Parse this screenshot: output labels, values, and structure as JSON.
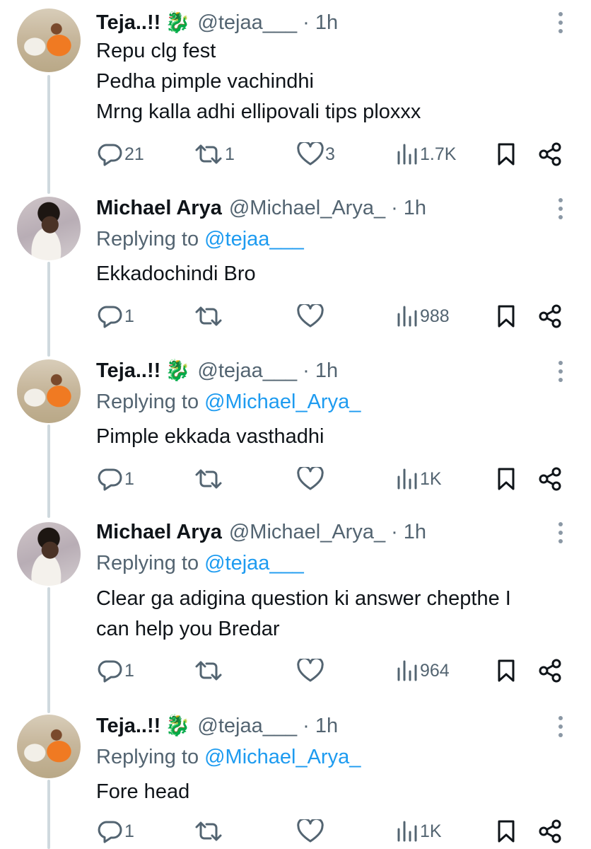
{
  "thread": {
    "tweets": [
      {
        "author": "Teja..!!",
        "author_emoji": "🐉",
        "handle": "@tejaa___",
        "time": "1h",
        "replying_label": "",
        "replying_to": "",
        "lines": [
          "Repu clg fest",
          "Pedha pimple vachindhi",
          "Mrng kalla adhi ellipovali tips ploxxx"
        ],
        "stats": {
          "replies": "21",
          "reposts": "1",
          "likes": "3",
          "views": "1.7K"
        }
      },
      {
        "author": "Michael Arya",
        "author_emoji": "",
        "handle": "@Michael_Arya_",
        "time": "1h",
        "replying_label": "Replying to",
        "replying_to": "@tejaa___",
        "lines": [
          "Ekkadochindi Bro"
        ],
        "stats": {
          "replies": "1",
          "reposts": "",
          "likes": "",
          "views": "988"
        }
      },
      {
        "author": "Teja..!!",
        "author_emoji": "🐉",
        "handle": "@tejaa___",
        "time": "1h",
        "replying_label": "Replying to",
        "replying_to": "@Michael_Arya_",
        "lines": [
          "Pimple ekkada vasthadhi"
        ],
        "stats": {
          "replies": "1",
          "reposts": "",
          "likes": "",
          "views": "1K"
        }
      },
      {
        "author": "Michael Arya",
        "author_emoji": "",
        "handle": "@Michael_Arya_",
        "time": "1h",
        "replying_label": "Replying to",
        "replying_to": "@tejaa___",
        "lines": [
          "Clear ga adigina question ki answer chepthe I",
          "can help you Bredar"
        ],
        "stats": {
          "replies": "1",
          "reposts": "",
          "likes": "",
          "views": "964"
        }
      },
      {
        "author": "Teja..!!",
        "author_emoji": "🐉",
        "handle": "@tejaa___",
        "time": "1h",
        "replying_label": "Replying to",
        "replying_to": "@Michael_Arya_",
        "lines": [
          "Fore head"
        ],
        "stats": {
          "replies": "1",
          "reposts": "",
          "likes": "",
          "views": "1K"
        }
      }
    ],
    "separator": "·",
    "colors": {
      "text": "#0f1419",
      "muted": "#536471",
      "link": "#1d9bf0",
      "thread_line": "#cfd9de"
    },
    "icons": [
      "reply-icon",
      "repost-icon",
      "like-icon",
      "views-icon",
      "bookmark-icon",
      "share-icon",
      "more-icon",
      "dragon-emoji"
    ]
  }
}
